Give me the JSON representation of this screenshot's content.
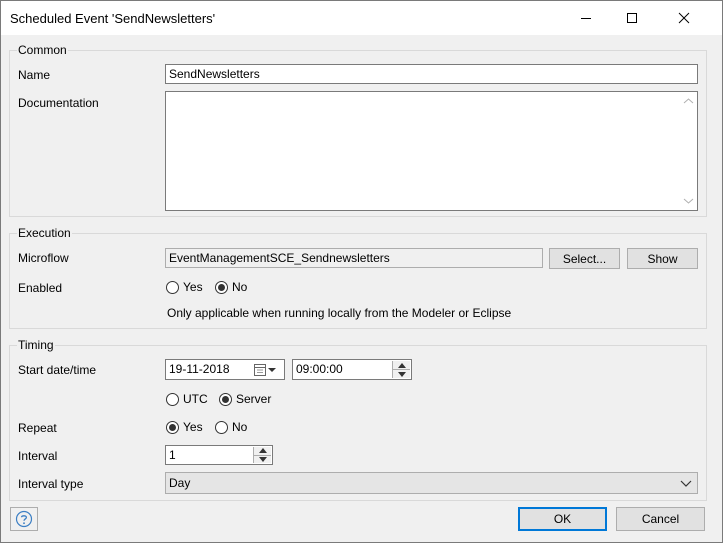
{
  "window": {
    "title": "Scheduled Event 'SendNewsletters'"
  },
  "common": {
    "group_label": "Common",
    "name_label": "Name",
    "name_value": "SendNewsletters",
    "documentation_label": "Documentation",
    "documentation_value": ""
  },
  "execution": {
    "group_label": "Execution",
    "microflow_label": "Microflow",
    "microflow_value": "EventManagementSCE_Sendnewsletters",
    "select_button": "Select...",
    "show_button": "Show",
    "enabled_label": "Enabled",
    "enabled_yes": "Yes",
    "enabled_no": "No",
    "enabled_selected": "No",
    "note": "Only applicable when running locally from the Modeler or Eclipse"
  },
  "timing": {
    "group_label": "Timing",
    "start_label": "Start date/time",
    "start_date": "19-11-2018",
    "start_time": "09:00:00",
    "utc_label": "UTC",
    "server_label": "Server",
    "timezone_selected": "Server",
    "repeat_label": "Repeat",
    "repeat_yes": "Yes",
    "repeat_no": "No",
    "repeat_selected": "Yes",
    "interval_label": "Interval",
    "interval_value": "1",
    "interval_type_label": "Interval type",
    "interval_type_value": "Day"
  },
  "footer": {
    "ok_button": "OK",
    "cancel_button": "Cancel"
  },
  "icons": {
    "help": "help-icon",
    "minimize": "minimize-icon",
    "maximize": "maximize-icon",
    "close": "close-icon",
    "calendar": "calendar-icon",
    "dropdown": "chevron-down-icon",
    "spinner": "spinner-arrows-icon"
  }
}
